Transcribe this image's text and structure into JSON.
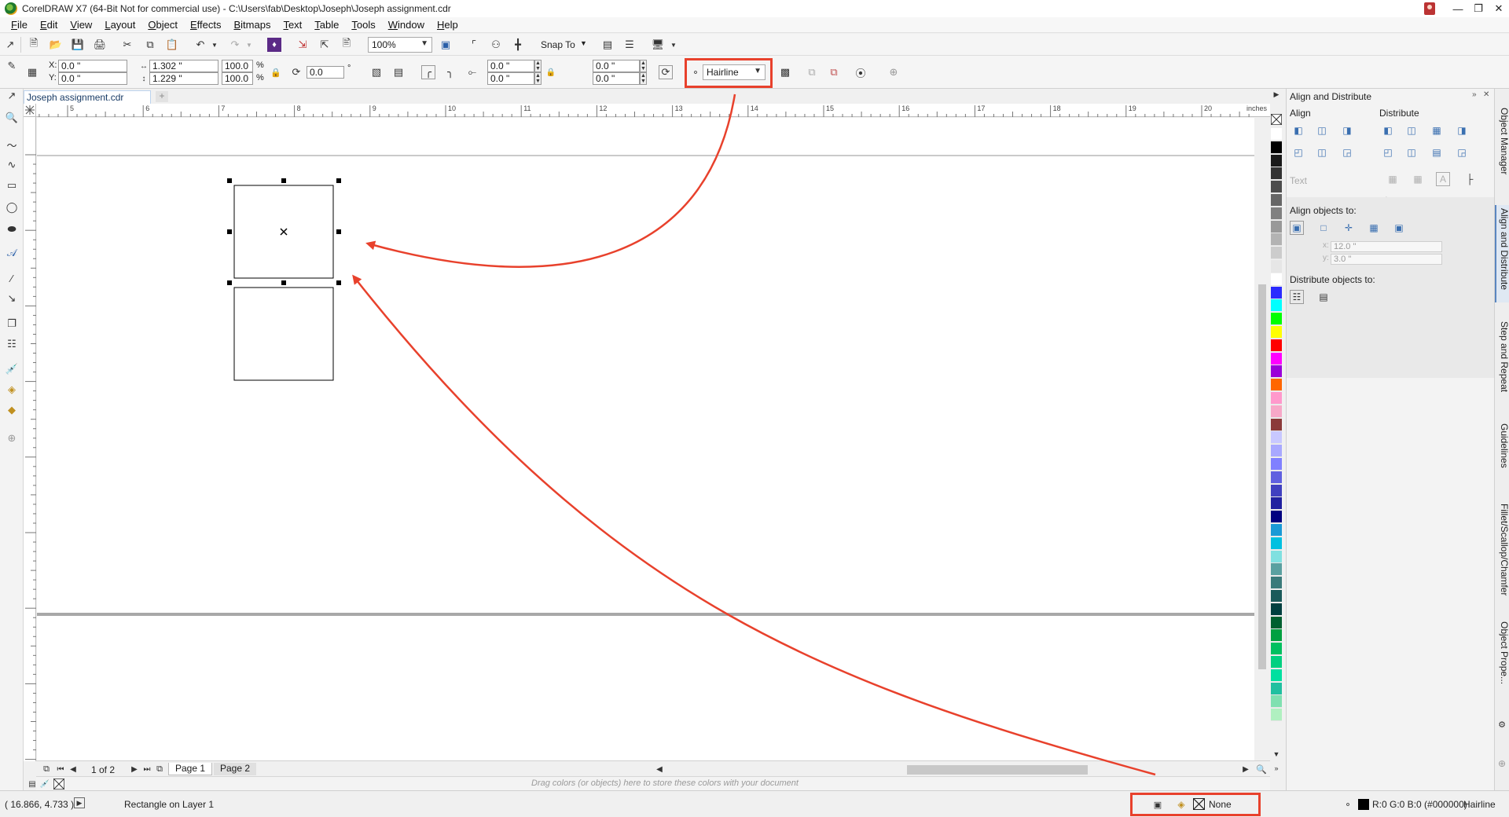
{
  "window": {
    "title": "CorelDRAW X7 (64-Bit Not for commercial use) - C:\\Users\\fab\\Desktop\\Joseph\\Joseph assignment.cdr"
  },
  "menu": [
    "File",
    "Edit",
    "View",
    "Layout",
    "Object",
    "Effects",
    "Bitmaps",
    "Text",
    "Table",
    "Tools",
    "Window",
    "Help"
  ],
  "standard_toolbar": {
    "zoom": "100%",
    "snap_to": "Snap To"
  },
  "property_bar": {
    "x": "0.0 \"",
    "y": "0.0 \"",
    "width": "1.302 \"",
    "height": "1.229 \"",
    "scale_w": "100.0",
    "scale_h": "100.0",
    "percent": "%",
    "rotation": "0.0",
    "degree": "°",
    "x_label": "X:",
    "y_label": "Y:",
    "corner_1": "0.0 \"",
    "corner_2": "0.0 \"",
    "corner_3": "0.0 \"",
    "corner_4": "0.0 \"",
    "outline_width": "Hairline"
  },
  "document": {
    "tab_name": "Joseph assignment.cdr",
    "add_tab": "+",
    "ruler_unit": "inches",
    "h_ruler_ticks": [
      "5",
      "6",
      "7",
      "8",
      "9",
      "10",
      "11",
      "12",
      "13",
      "14",
      "15",
      "16",
      "17",
      "18",
      "19",
      "20"
    ]
  },
  "page_nav": {
    "counter": "1 of 2",
    "pages": [
      "Page 1",
      "Page 2"
    ]
  },
  "palette_colors": [
    "#ffffff",
    "#000000",
    "#1a1a1a",
    "#333333",
    "#4d4d4d",
    "#666666",
    "#808080",
    "#999999",
    "#b3b3b3",
    "#cccccc",
    "#e6e6e6",
    "#ffffff",
    "#2b2bff",
    "#00ffff",
    "#00ff00",
    "#ffff00",
    "#ff0000",
    "#ff00ff",
    "#9b00d9",
    "#ff6600",
    "#ff99cc",
    "#f7a8c8",
    "#8b3a3a",
    "#c8c8ff",
    "#a8a8ff",
    "#8080ff",
    "#6060e0",
    "#4040c0",
    "#2020a0",
    "#000080",
    "#1a9ad6",
    "#00c0e0",
    "#80e0e0",
    "#5aa0a0",
    "#3a7a7a",
    "#1a5a5a",
    "#004040",
    "#006030",
    "#00a040",
    "#00c060",
    "#00d080",
    "#00e0a0",
    "#20c0a0",
    "#80e0b0",
    "#b0f0c0"
  ],
  "docker": {
    "title": "Align and Distribute",
    "align_label": "Align",
    "distribute_label": "Distribute",
    "text_label": "Text",
    "align_objects_to": "Align objects to:",
    "x_label": "x:",
    "x_value": "12.0 \"",
    "y_label": "y:",
    "y_value": "3.0 \"",
    "distribute_objects_to": "Distribute objects to:"
  },
  "side_tabs": [
    "Object Manager",
    "Align and Distribute",
    "Step and Repeat",
    "Guidelines",
    "Fillet/Scallop/Chamfer",
    "Object Prope..."
  ],
  "docpal_hint": "Drag colors (or objects) here to store these colors with your document",
  "status": {
    "coords": "( 16.866, 4.733 )",
    "object_info": "Rectangle on Layer 1",
    "fill": "None",
    "outline_color": "R:0 G:0 B:0 (#000000)",
    "outline_width": "Hairline"
  }
}
